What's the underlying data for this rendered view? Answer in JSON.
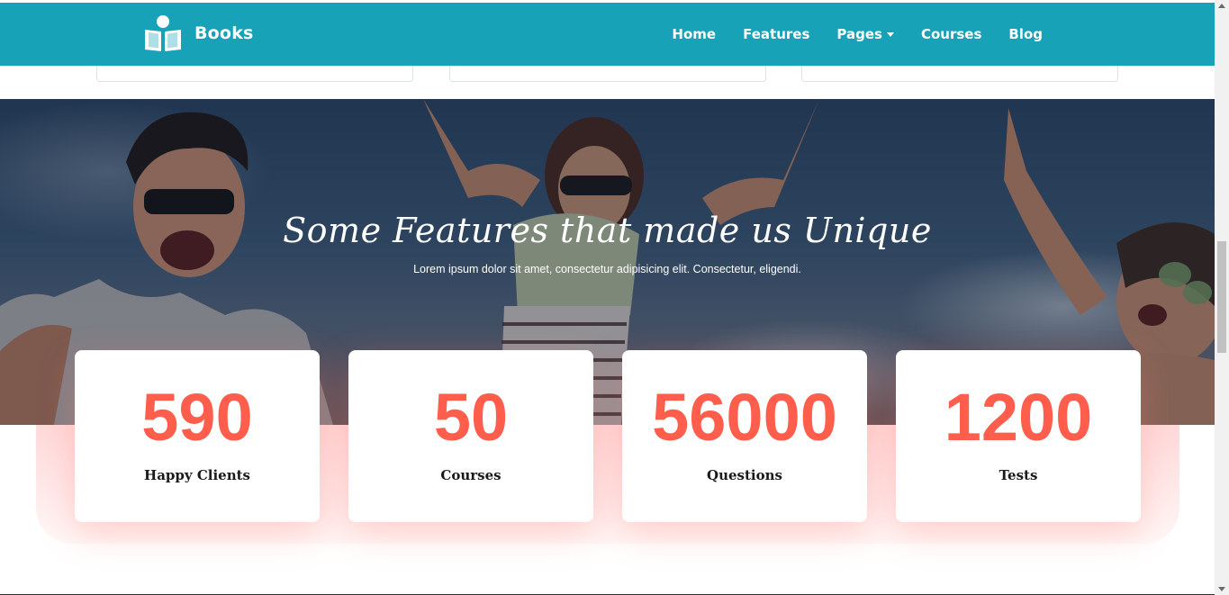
{
  "navbar": {
    "brand": "Books",
    "brand_icon": "reader-book-icon",
    "color": "#17a2b8",
    "links": [
      "Home",
      "Features",
      "Pages",
      "Courses",
      "Blog"
    ]
  },
  "hero": {
    "title": "Some Features that made us Unique",
    "subtitle": "Lorem ipsum dolor sit amet, consectetur adipisicing elit. Consectetur, eligendi."
  },
  "stats": [
    {
      "value": "590",
      "label": "Happy Clients"
    },
    {
      "value": "50",
      "label": "Courses"
    },
    {
      "value": "56000",
      "label": "Questions"
    },
    {
      "value": "1200",
      "label": "Tests"
    }
  ],
  "colors": {
    "accent": "#ff5e4d",
    "nav": "#17a2b8"
  }
}
